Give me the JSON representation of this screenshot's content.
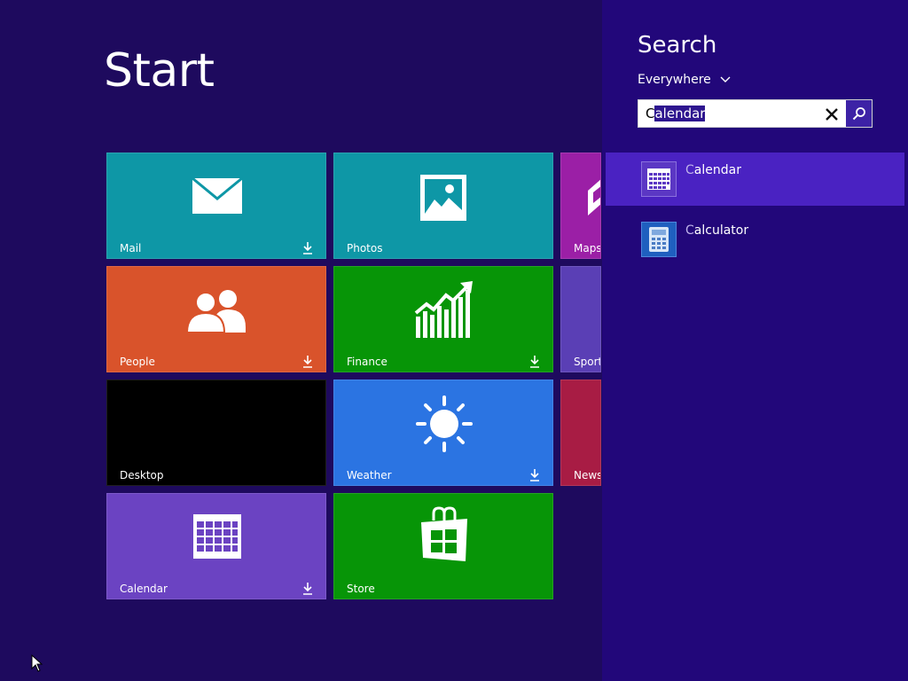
{
  "start": {
    "title": "Start"
  },
  "tiles": {
    "mail": {
      "label": "Mail",
      "color": "#0e97a6"
    },
    "photos": {
      "label": "Photos",
      "color": "#0e97a6"
    },
    "maps": {
      "label": "Maps",
      "color": "#9b1fa6"
    },
    "people": {
      "label": "People",
      "color": "#d9532b"
    },
    "finance": {
      "label": "Finance",
      "color": "#079507"
    },
    "sports": {
      "label": "Sports",
      "color": "#5a3fb5"
    },
    "desktop": {
      "label": "Desktop",
      "color": "#000000"
    },
    "weather": {
      "label": "Weather",
      "color": "#2b74e2"
    },
    "news": {
      "label": "News",
      "color": "#a81c44"
    },
    "calendar": {
      "label": "Calendar",
      "color": "#6b43c2"
    },
    "store": {
      "label": "Store",
      "color": "#079507"
    }
  },
  "search": {
    "title": "Search",
    "scope": "Everywhere",
    "query_prefix": "C",
    "query_selected": "alendar",
    "results": [
      {
        "label_hl": "C",
        "label_rest": "alendar",
        "icon": "calendar-app-icon"
      },
      {
        "label_hl": "C",
        "label_rest": "alculator",
        "icon": "calculator-app-icon"
      }
    ]
  },
  "colors": {
    "background": "#1e0a5e",
    "charm": "#22077a",
    "result_highlight": "#4a22c2"
  }
}
